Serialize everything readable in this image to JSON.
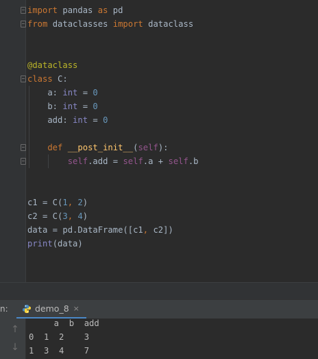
{
  "editor": {
    "lines": [
      {
        "parts": [
          {
            "t": "import",
            "c": "kw"
          },
          {
            "t": " pandas ",
            "c": "plain"
          },
          {
            "t": "as",
            "c": "kw"
          },
          {
            "t": " pd",
            "c": "plain"
          }
        ]
      },
      {
        "parts": [
          {
            "t": "from",
            "c": "kw"
          },
          {
            "t": " dataclasses ",
            "c": "plain"
          },
          {
            "t": "import",
            "c": "kw"
          },
          {
            "t": " dataclass",
            "c": "plain"
          }
        ]
      },
      {
        "parts": []
      },
      {
        "parts": []
      },
      {
        "parts": [
          {
            "t": "@dataclass",
            "c": "deco"
          }
        ]
      },
      {
        "parts": [
          {
            "t": "class",
            "c": "kw"
          },
          {
            "t": " C:",
            "c": "plain"
          }
        ]
      },
      {
        "parts": [
          {
            "t": "    a: ",
            "c": "plain"
          },
          {
            "t": "int",
            "c": "builtin"
          },
          {
            "t": " = ",
            "c": "plain"
          },
          {
            "t": "0",
            "c": "num"
          }
        ]
      },
      {
        "parts": [
          {
            "t": "    b: ",
            "c": "plain"
          },
          {
            "t": "int",
            "c": "builtin"
          },
          {
            "t": " = ",
            "c": "plain"
          },
          {
            "t": "0",
            "c": "num"
          }
        ]
      },
      {
        "parts": [
          {
            "t": "    add: ",
            "c": "plain"
          },
          {
            "t": "int",
            "c": "builtin"
          },
          {
            "t": " = ",
            "c": "plain"
          },
          {
            "t": "0",
            "c": "num"
          }
        ]
      },
      {
        "parts": []
      },
      {
        "parts": [
          {
            "t": "    def",
            "c": "kw"
          },
          {
            "t": " ",
            "c": "plain"
          },
          {
            "t": "__post_init__",
            "c": "fn"
          },
          {
            "t": "(",
            "c": "plain"
          },
          {
            "t": "self",
            "c": "param"
          },
          {
            "t": "):",
            "c": "plain"
          }
        ]
      },
      {
        "parts": [
          {
            "t": "        ",
            "c": "plain"
          },
          {
            "t": "self",
            "c": "self"
          },
          {
            "t": ".add = ",
            "c": "plain"
          },
          {
            "t": "self",
            "c": "self"
          },
          {
            "t": ".a + ",
            "c": "plain"
          },
          {
            "t": "self",
            "c": "self"
          },
          {
            "t": ".b",
            "c": "plain"
          }
        ]
      },
      {
        "parts": []
      },
      {
        "parts": []
      },
      {
        "parts": [
          {
            "t": "c1 = C(",
            "c": "plain"
          },
          {
            "t": "1",
            "c": "num"
          },
          {
            "t": ", ",
            "c": "kw"
          },
          {
            "t": "2",
            "c": "num"
          },
          {
            "t": ")",
            "c": "plain"
          }
        ]
      },
      {
        "parts": [
          {
            "t": "c2 = C(",
            "c": "plain"
          },
          {
            "t": "3",
            "c": "num"
          },
          {
            "t": ", ",
            "c": "kw"
          },
          {
            "t": "4",
            "c": "num"
          },
          {
            "t": ")",
            "c": "plain"
          }
        ]
      },
      {
        "parts": [
          {
            "t": "data = pd.DataFrame([c1",
            "c": "plain"
          },
          {
            "t": ", ",
            "c": "kw"
          },
          {
            "t": "c2])",
            "c": "plain"
          }
        ]
      },
      {
        "parts": [
          {
            "t": "print",
            "c": "builtin"
          },
          {
            "t": "(data)",
            "c": "plain"
          }
        ]
      }
    ]
  },
  "run_panel": {
    "prefix": "n:",
    "tab_label": "demo_8",
    "close_glyph": "×",
    "icons": [
      "python-icon",
      "close-icon",
      "arrow-up-icon",
      "arrow-down-icon"
    ],
    "output": [
      "     a  b  add",
      "0  1  2    3",
      "1  3  4    7"
    ]
  },
  "colors": {
    "keyword": "#cc7832",
    "number": "#6897bb",
    "decorator": "#bbb529",
    "self": "#94558d",
    "function": "#ffc66d",
    "builtin": "#8888c6",
    "text": "#a9b7c6",
    "background": "#2b2b2b",
    "tab_underline": "#4a88c7"
  }
}
